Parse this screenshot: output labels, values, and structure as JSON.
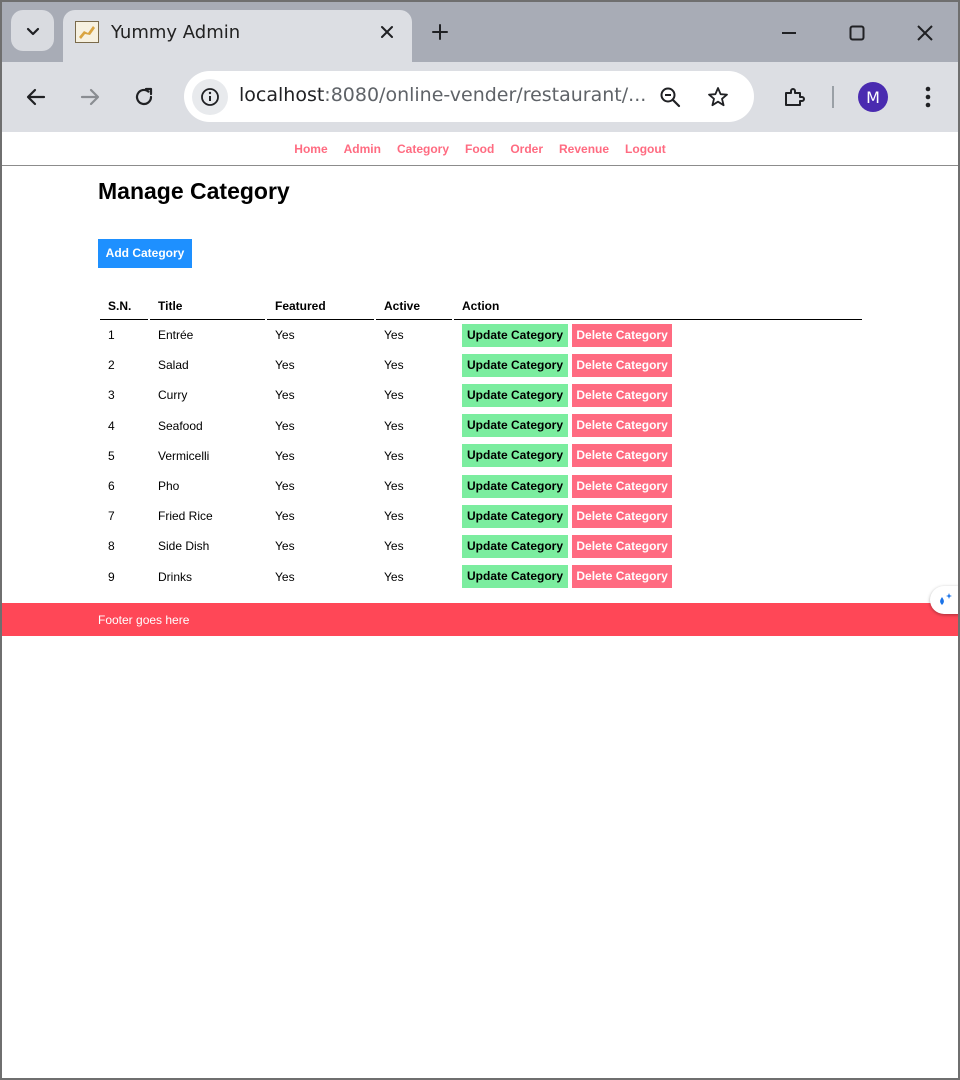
{
  "browser": {
    "tab_title": "Yummy Admin",
    "url_host": "localhost",
    "url_rest": ":8080/online-vender/restaurant/...",
    "profile_initial": "M"
  },
  "nav": {
    "items": [
      "Home",
      "Admin",
      "Category",
      "Food",
      "Order",
      "Revenue",
      "Logout"
    ]
  },
  "page": {
    "title": "Manage Category",
    "add_button": "Add Category"
  },
  "table": {
    "headers": [
      "S.N.",
      "Title",
      "Featured",
      "Active",
      "Action"
    ],
    "rows": [
      {
        "sn": "1",
        "title": "Entrée",
        "featured": "Yes",
        "active": "Yes"
      },
      {
        "sn": "2",
        "title": "Salad",
        "featured": "Yes",
        "active": "Yes"
      },
      {
        "sn": "3",
        "title": "Curry",
        "featured": "Yes",
        "active": "Yes"
      },
      {
        "sn": "4",
        "title": "Seafood",
        "featured": "Yes",
        "active": "Yes"
      },
      {
        "sn": "5",
        "title": "Vermicelli",
        "featured": "Yes",
        "active": "Yes"
      },
      {
        "sn": "6",
        "title": "Pho",
        "featured": "Yes",
        "active": "Yes"
      },
      {
        "sn": "7",
        "title": "Fried Rice",
        "featured": "Yes",
        "active": "Yes"
      },
      {
        "sn": "8",
        "title": "Side Dish",
        "featured": "Yes",
        "active": "Yes"
      },
      {
        "sn": "9",
        "title": "Drinks",
        "featured": "Yes",
        "active": "Yes"
      }
    ],
    "update_label": "Update Category",
    "delete_label": "Delete Category"
  },
  "footer": {
    "text": "Footer goes here"
  },
  "colors": {
    "nav_link": "#ff6b81",
    "primary": "#1e90ff",
    "update": "#7bed9f",
    "delete": "#ff6b81",
    "footer": "#ff4757"
  }
}
